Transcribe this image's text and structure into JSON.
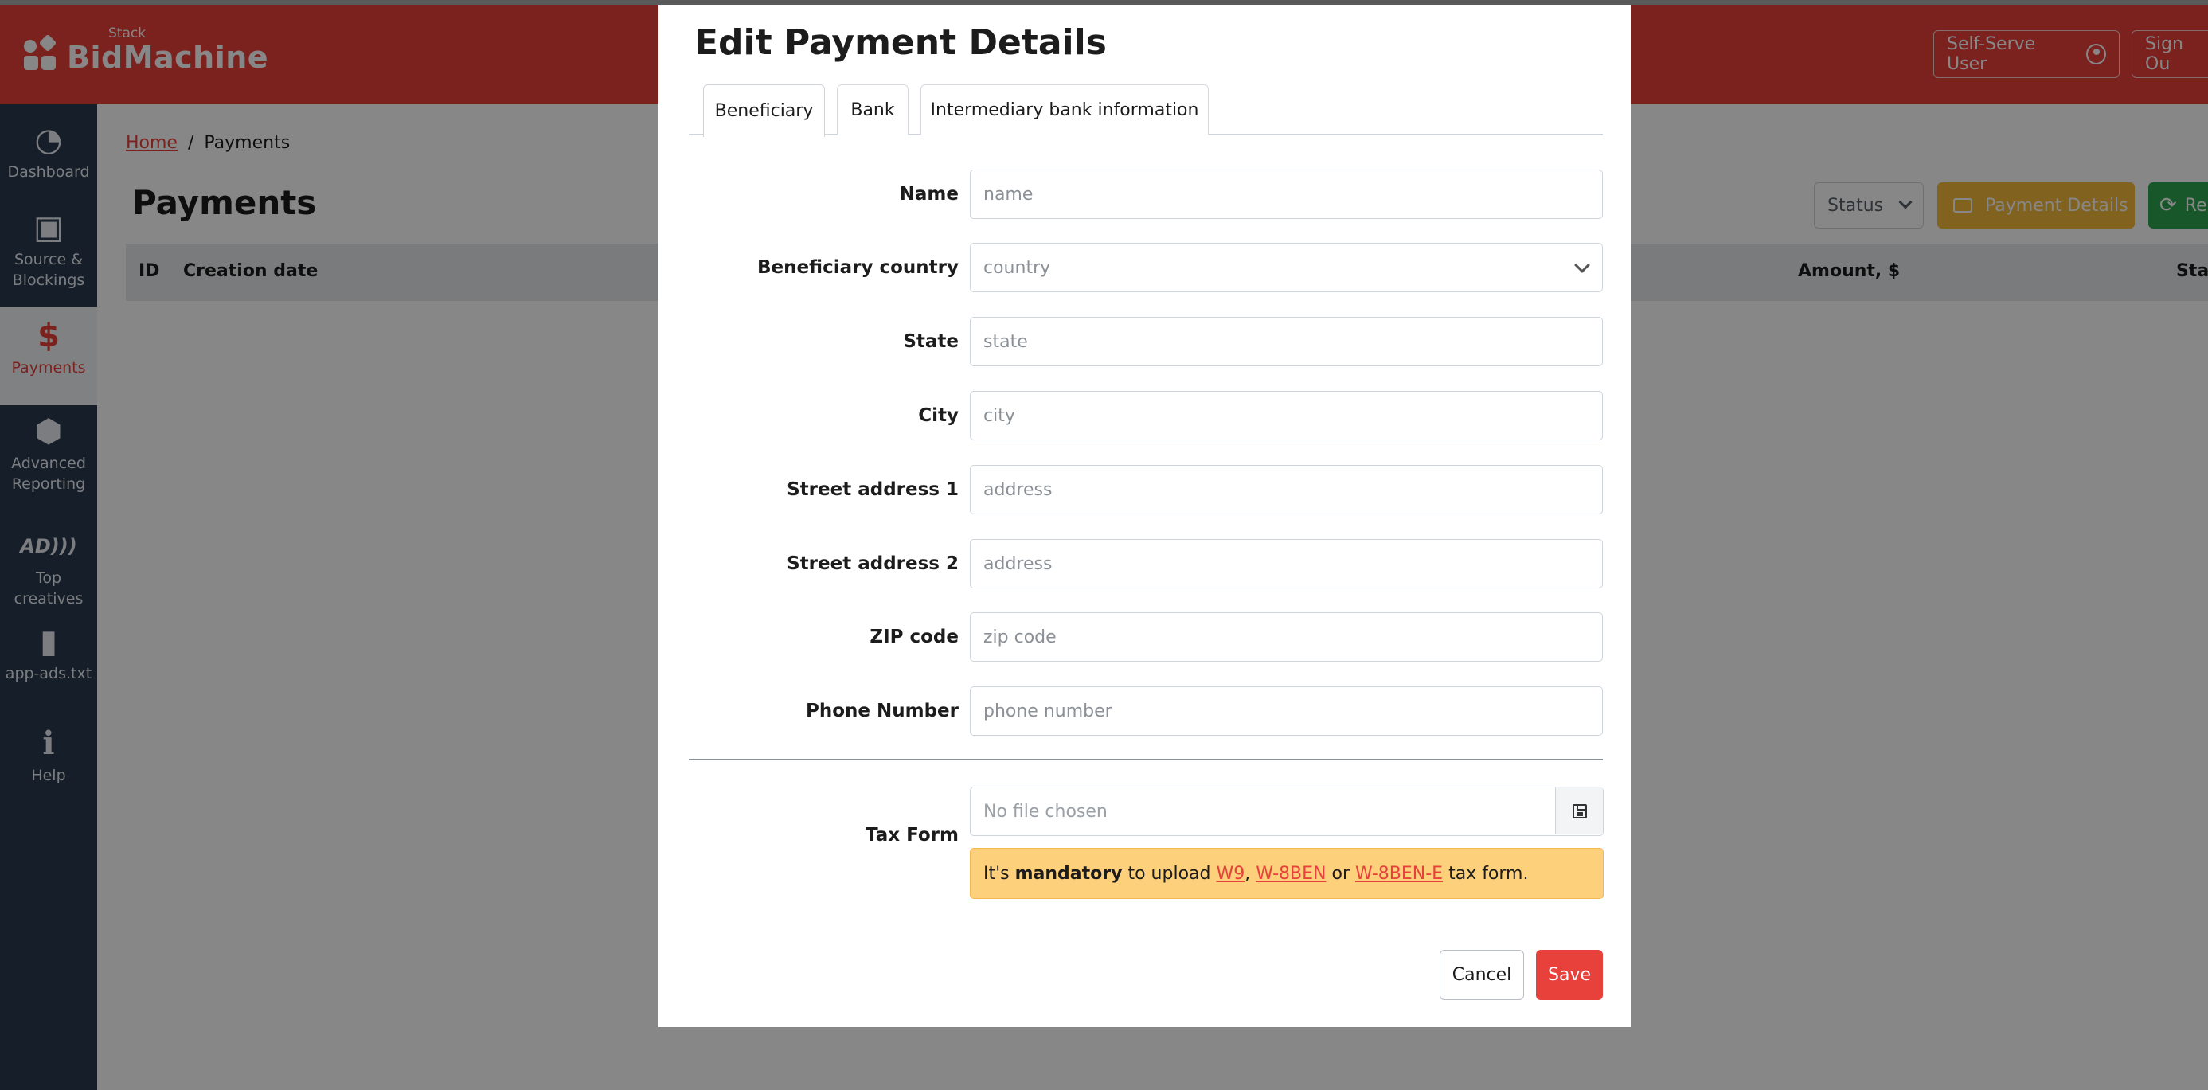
{
  "app": {
    "logo_sub": "Stack",
    "logo_main": "BidMachine"
  },
  "header": {
    "user_label": "Self-Serve User",
    "signout_label": "Sign Ou"
  },
  "sidebar": {
    "items": [
      {
        "label": "Dashboard",
        "icon": "dashboard-icon"
      },
      {
        "label": "Source & Blockings",
        "icon": "briefcase-icon"
      },
      {
        "label": "Payments",
        "icon": "dollar-icon",
        "active": true
      },
      {
        "label": "Advanced Reporting",
        "icon": "cubes-icon"
      },
      {
        "label": "Top creatives",
        "icon": "ad-icon"
      },
      {
        "label": "app-ads.txt",
        "icon": "file-icon"
      },
      {
        "label": "Help",
        "icon": "info-icon"
      }
    ]
  },
  "breadcrumb": {
    "home": "Home",
    "separator": "/",
    "current": "Payments"
  },
  "page": {
    "title": "Payments",
    "status_filter": "Status",
    "payment_details_button": "Payment Details",
    "refresh_button": "Re"
  },
  "table": {
    "columns": [
      "ID",
      "Creation date",
      "Amount, $",
      "Stat"
    ]
  },
  "modal": {
    "title": "Edit Payment Details",
    "tabs": [
      "Beneficiary",
      "Bank",
      "Intermediary bank information"
    ],
    "fields": [
      {
        "label": "Name",
        "placeholder": "name",
        "type": "input"
      },
      {
        "label": "Beneficiary country",
        "placeholder": "country",
        "type": "select"
      },
      {
        "label": "State",
        "placeholder": "state",
        "type": "input"
      },
      {
        "label": "City",
        "placeholder": "city",
        "type": "input"
      },
      {
        "label": "Street address 1",
        "placeholder": "address",
        "type": "input"
      },
      {
        "label": "Street address 2",
        "placeholder": "address",
        "type": "input"
      },
      {
        "label": "ZIP code",
        "placeholder": "zip code",
        "type": "input"
      },
      {
        "label": "Phone Number",
        "placeholder": "phone number",
        "type": "input"
      }
    ],
    "tax_form": {
      "label": "Tax Form",
      "file_placeholder": "No file chosen",
      "alert": {
        "prefix": "It's ",
        "bold": "mandatory",
        "middle": " to upload ",
        "link1": "W9",
        "sep1": ", ",
        "link2": "W-8BEN",
        "sep2": " or ",
        "link3": "W-8BEN-E",
        "suffix": " tax form."
      }
    },
    "cancel_label": "Cancel",
    "save_label": "Save"
  },
  "colors": {
    "brand_red": "#e8413c",
    "sidebar_bg": "#2b3b4e",
    "warning": "#fdd07c",
    "payment_btn": "#f6b93b",
    "green_btn": "#2ea44f"
  }
}
